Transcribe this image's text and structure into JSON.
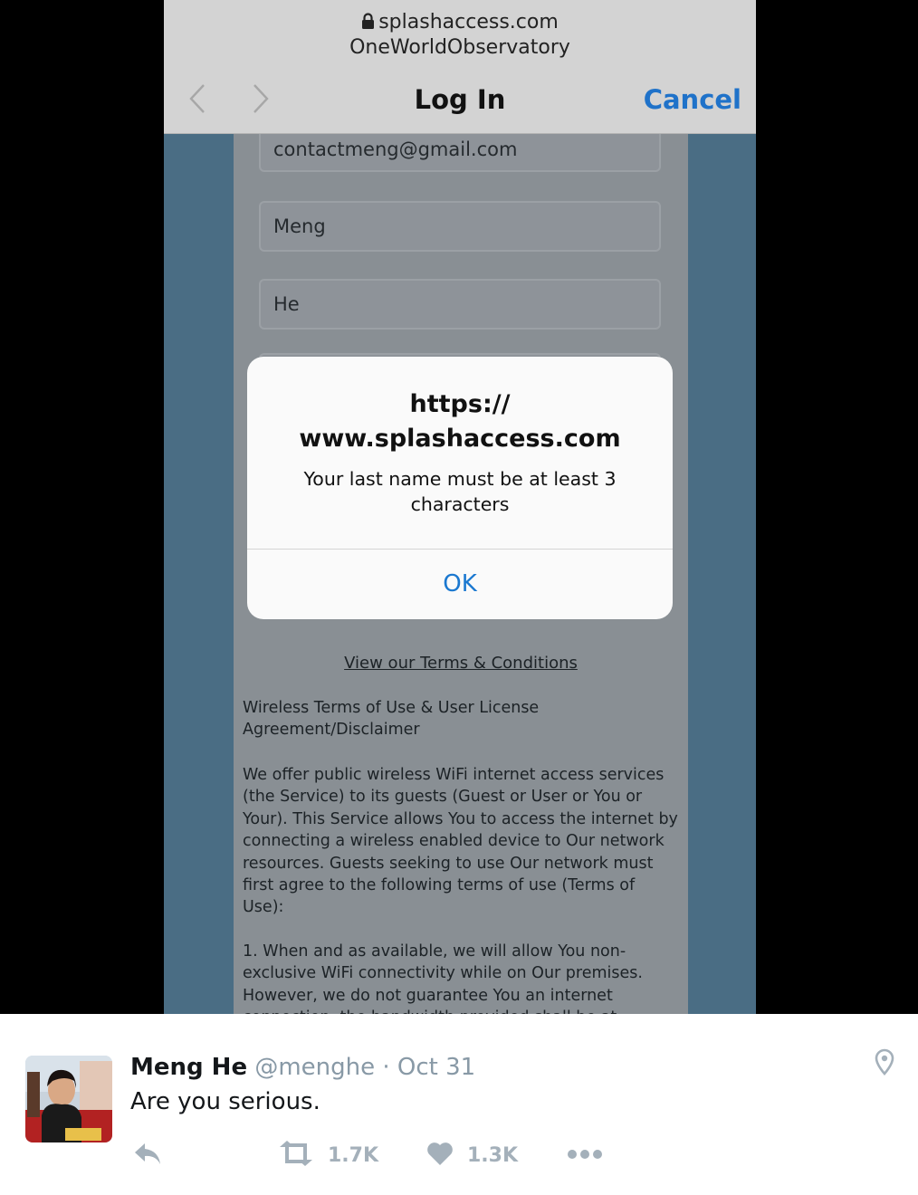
{
  "browser": {
    "url": "splashaccess.com",
    "site_name": "OneWorldObservatory",
    "title": "Log In",
    "cancel_label": "Cancel"
  },
  "form": {
    "email_value": "contactmeng@gmail.com",
    "first_name_value": "Meng",
    "last_name_value": "He"
  },
  "alert": {
    "title": "https://\nwww.splashaccess.com",
    "message": "Your last name must be at least 3 characters",
    "ok_label": "OK"
  },
  "page": {
    "terms_link": "View our Terms & Conditions",
    "paragraph_1": "Wireless Terms of Use & User License Agreement/Disclaimer",
    "paragraph_2": "We offer public wireless WiFi internet access services (the Service) to its guests (Guest or User or You or Your). This Service allows You to access the internet by connecting a wireless enabled device to Our network resources. Guests seeking to use Our network must first agree to the following terms of use (Terms of Use):",
    "paragraph_3": "1. When and as available, we will allow You non-exclusive WiFi connectivity while on Our premises. However, we do not guarantee You an internet connection, the bandwidth provided shall be at"
  },
  "tweet": {
    "name": "Meng He",
    "handle": "@menghe",
    "separator": "·",
    "date": "Oct 31",
    "text": "Are you serious.",
    "retweet_count": "1.7K",
    "like_count": "1.3K"
  },
  "icons": {
    "lock": "lock-icon",
    "back": "chevron-left-icon",
    "forward": "chevron-right-icon",
    "location": "location-pin-icon",
    "reply": "reply-icon",
    "retweet": "retweet-icon",
    "like": "heart-icon",
    "more": "more-dots-icon"
  },
  "colors": {
    "ios_blue": "#1a78d0",
    "tweet_gray": "#8899a6",
    "action_gray": "#a4b0ba"
  }
}
